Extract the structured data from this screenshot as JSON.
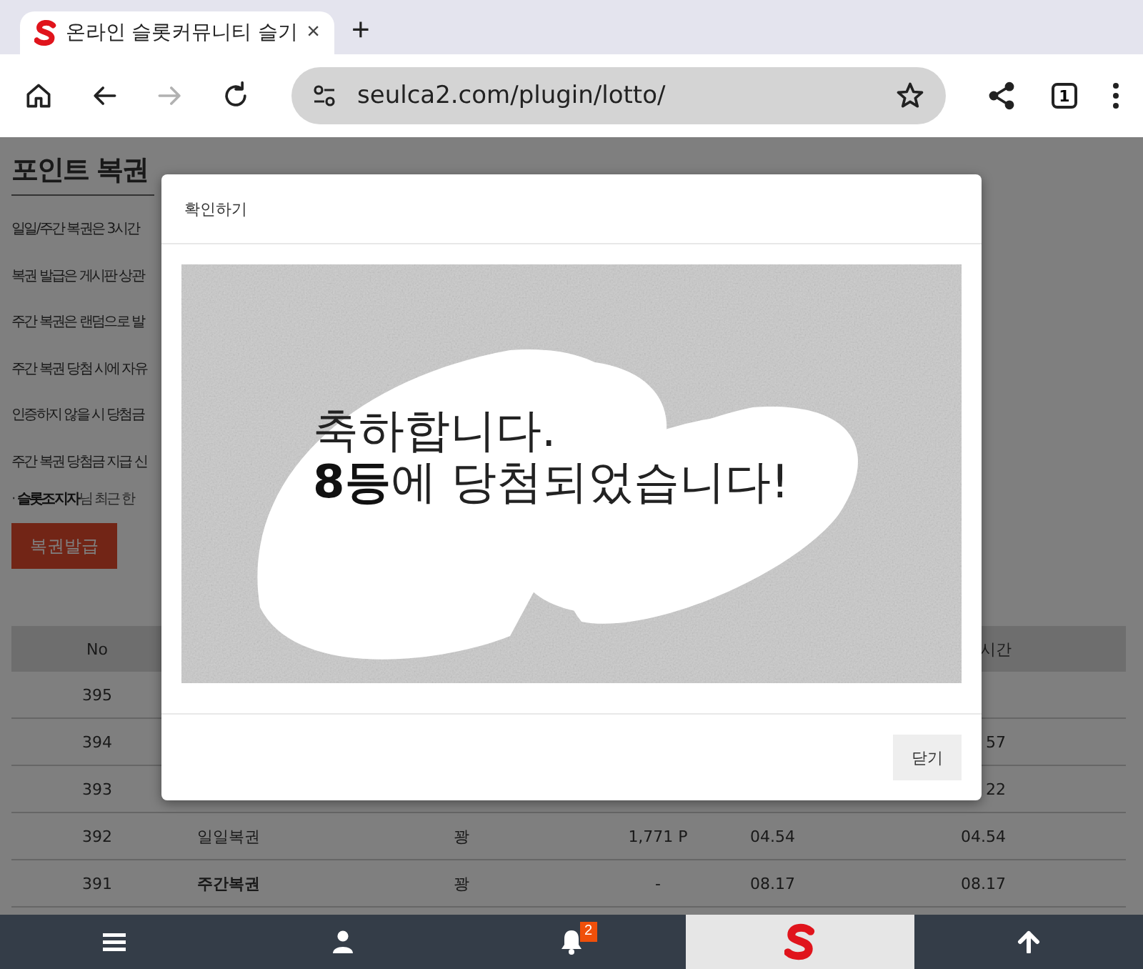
{
  "browser": {
    "tab": {
      "title": "온라인 슬롯커뮤니티 슬기",
      "selected": true
    },
    "close_tab": "×",
    "new_tab": "+",
    "address": "seulca2.com/plugin/lotto/",
    "forward_disabled": true,
    "tab_count": "1"
  },
  "page": {
    "heading": "포인트 복권",
    "notes": [
      "일일/주간 복권은 3시간",
      "복권 발급은 게시판 상관",
      "주간 복권은 랜덤으로 발",
      "주간 복권 당첨 시에 자유",
      "인증하지 않을 시 당첨금",
      "주간 복권 당첨금 지급 신"
    ],
    "recent": "· **슬롯조지자**님 최근 한",
    "issue_button": "복권발급",
    "table": {
      "header": {
        "no": "No",
        "column_6": "시간"
      },
      "rows": [
        {
          "no": "395"
        },
        {
          "no": "394",
          "column_6": "57"
        },
        {
          "no": "393",
          "column_6": "22"
        },
        {
          "no": "392",
          "kind": "daily",
          "column_2": "일일복권",
          "column_3": "꽝",
          "column_4": "1,771 P",
          "column_5": "04.54",
          "column_6": "04.54"
        },
        {
          "no": "391",
          "kind": "weekly",
          "column_2": "주간복권",
          "column_3": "꽝",
          "column_4": "-",
          "column_5": "08.17",
          "column_6": "08.17"
        }
      ]
    }
  },
  "modal": {
    "title": "확인하기",
    "message": [
      "축하합니다.",
      "**8등**에 당첨되었습니다!"
    ],
    "close_button": "닫기"
  },
  "bottom_nav": [
    {
      "kind": "menu",
      "selected": false
    },
    {
      "kind": "user",
      "selected": false
    },
    {
      "kind": "bell",
      "selected": false,
      "badge": "2"
    },
    {
      "kind": "logo",
      "selected": true
    },
    {
      "kind": "top",
      "selected": false
    }
  ]
}
